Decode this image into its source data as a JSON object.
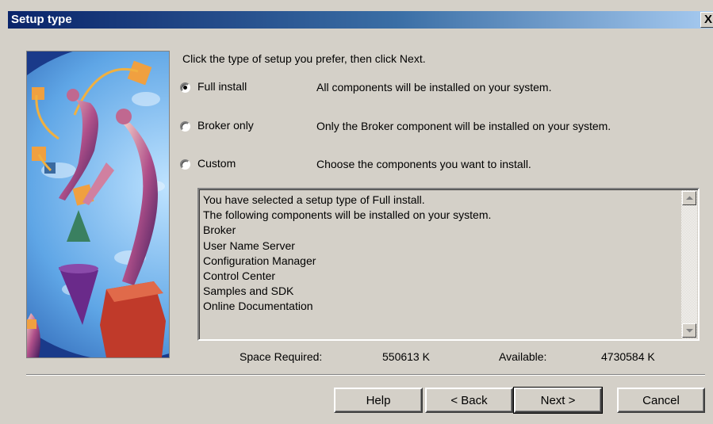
{
  "window": {
    "title": "Setup type",
    "close_glyph": "X"
  },
  "main": {
    "prompt": "Click the type of setup you prefer, then click Next.",
    "options": [
      {
        "label": "Full install",
        "description": "All components will be installed on your system.",
        "selected": true
      },
      {
        "label": "Broker only",
        "description": "Only the Broker component will be installed on your system.",
        "selected": false
      },
      {
        "label": "Custom",
        "description": "Choose the components you want to install.",
        "selected": false
      }
    ],
    "details_lines": [
      "You have selected a setup type of Full install.",
      "The following components will be installed on your system.",
      "Broker",
      "User Name Server",
      "Configuration Manager",
      "Control Center",
      "Samples and SDK",
      "Online Documentation"
    ],
    "space_required_label": "Space Required:",
    "space_required_value": "550613 K",
    "available_label": "Available:",
    "available_value": "4730584 K"
  },
  "buttons": {
    "help": "Help",
    "back": "< Back",
    "next": "Next >",
    "cancel": "Cancel"
  },
  "icons": {
    "scroll_up": "arrow-up-icon",
    "scroll_down": "arrow-down-icon"
  },
  "colors": {
    "title_bar_start": "#0a246a",
    "title_bar_end": "#a6caf0",
    "dialog_face": "#d4d0c8"
  }
}
